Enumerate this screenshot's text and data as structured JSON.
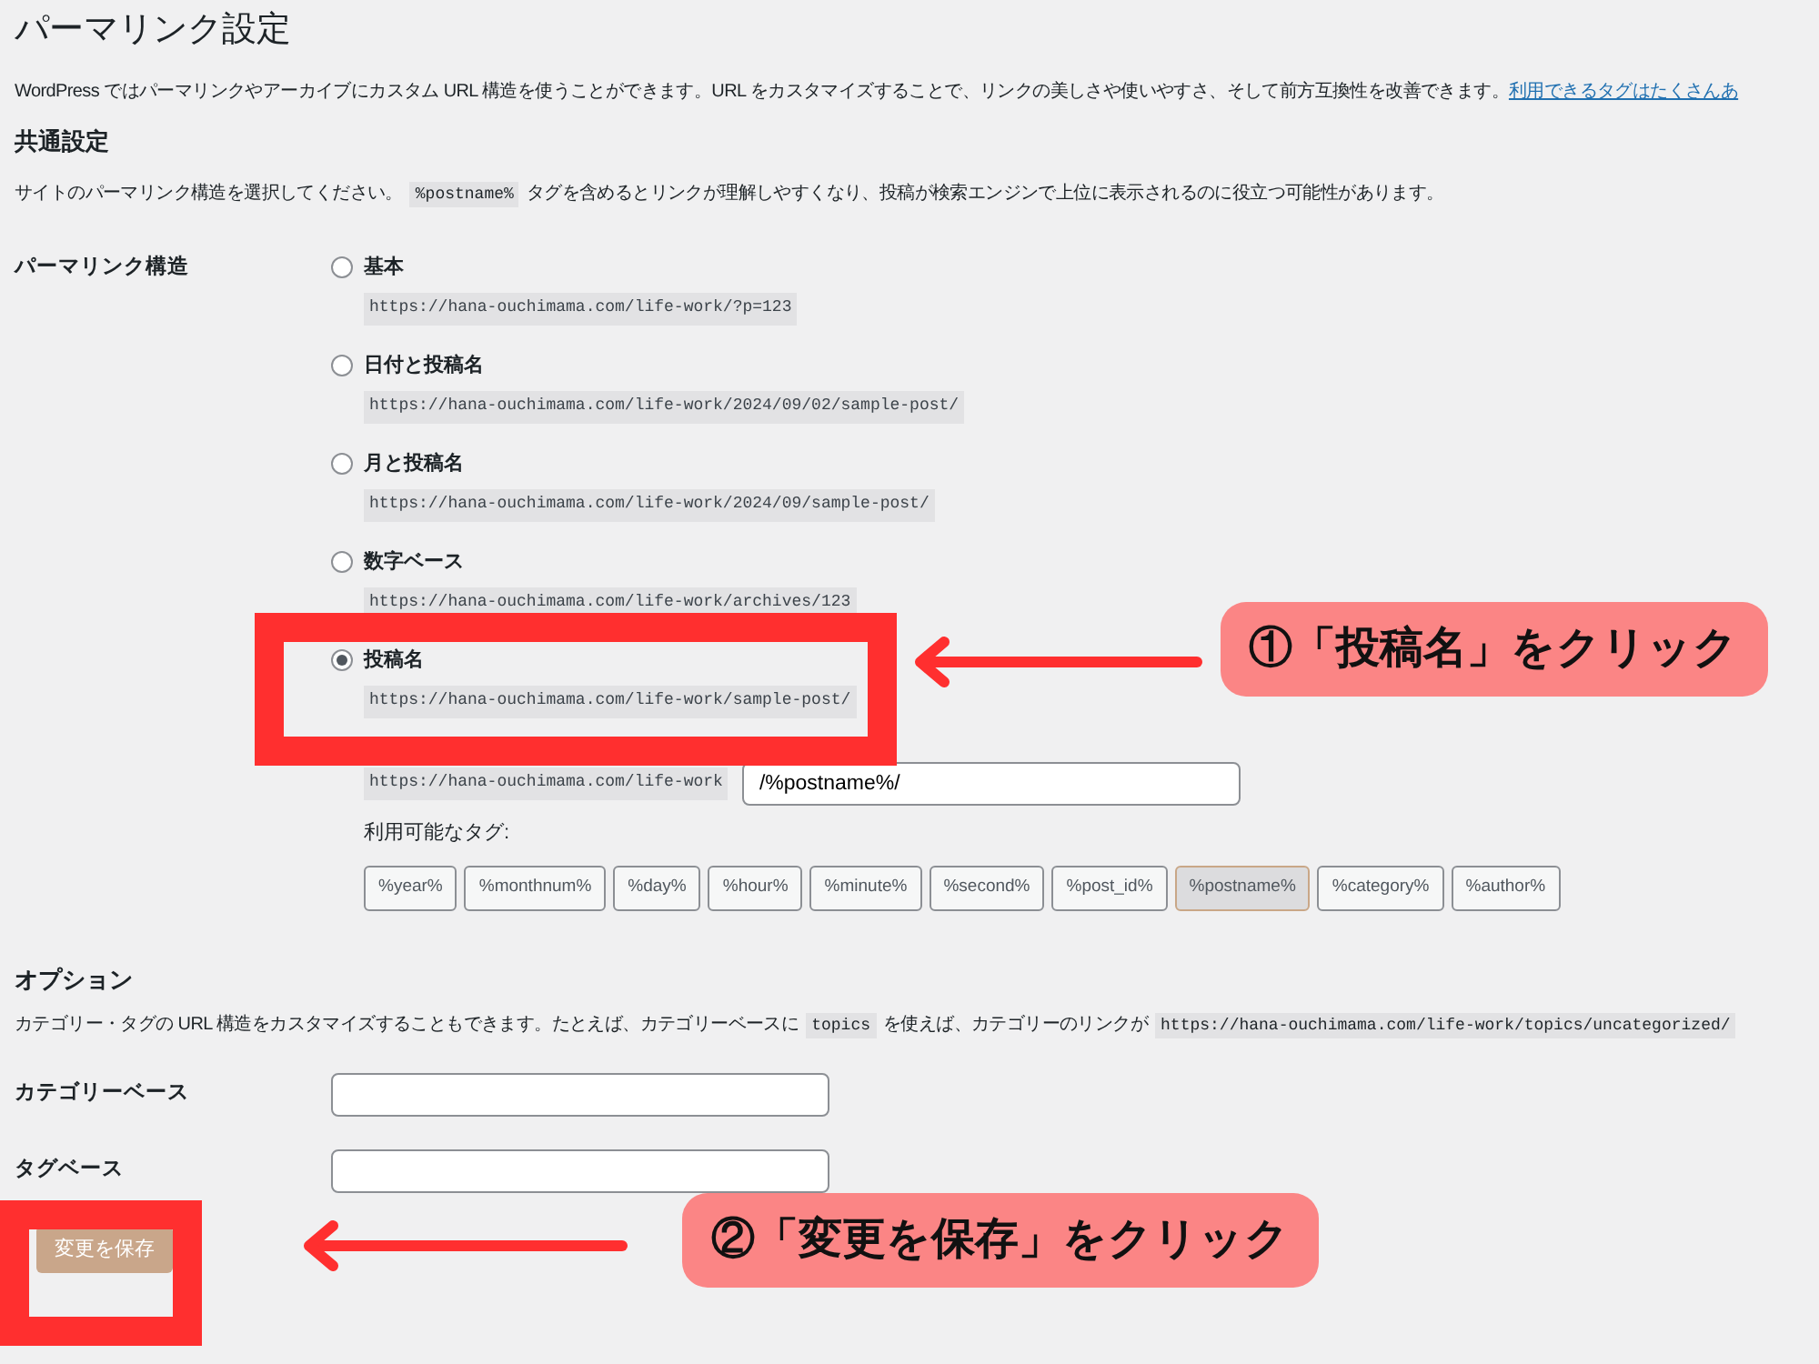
{
  "title": "パーマリンク設定",
  "intro": {
    "text": "WordPress ではパーマリンクやアーカイブにカスタム URL 構造を使うことができます。URL をカスタマイズすることで、リンクの美しさや使いやすさ、そして前方互換性を改善できます。",
    "link": "利用できるタグはたくさんあ"
  },
  "common": {
    "heading": "共通設定",
    "description": [
      {
        "kind": "text",
        "text": "サイトのパーマリンク構造を選択してください。"
      },
      {
        "kind": "code",
        "text": "%postname%"
      },
      {
        "kind": "text",
        "text": "タグを含めるとリンクが理解しやすくなり、投稿が検索エンジンで上位に表示されるのに役立つ可能性があります。"
      }
    ]
  },
  "structure": {
    "label": "パーマリンク構造",
    "options": [
      {
        "label": "基本",
        "example": "https://hana-ouchimama.com/life-work/?p=123",
        "selected": false
      },
      {
        "label": "日付と投稿名",
        "example": "https://hana-ouchimama.com/life-work/2024/09/02/sample-post/",
        "selected": false
      },
      {
        "label": "月と投稿名",
        "example": "https://hana-ouchimama.com/life-work/2024/09/sample-post/",
        "selected": false
      },
      {
        "label": "数字ベース",
        "example": "https://hana-ouchimama.com/life-work/archives/123",
        "selected": false
      },
      {
        "label": "投稿名",
        "example": "https://hana-ouchimama.com/life-work/sample-post/",
        "selected": true
      }
    ],
    "custom": {
      "prefix": "https://hana-ouchimama.com/life-work",
      "value": "/%postname%/",
      "tags_label": "利用可能なタグ:",
      "tags": [
        {
          "label": "%year%",
          "selected": false
        },
        {
          "label": "%monthnum%",
          "selected": false
        },
        {
          "label": "%day%",
          "selected": false
        },
        {
          "label": "%hour%",
          "selected": false
        },
        {
          "label": "%minute%",
          "selected": false
        },
        {
          "label": "%second%",
          "selected": false
        },
        {
          "label": "%post_id%",
          "selected": false
        },
        {
          "label": "%postname%",
          "selected": true
        },
        {
          "label": "%category%",
          "selected": false
        },
        {
          "label": "%author%",
          "selected": false
        }
      ]
    }
  },
  "options": {
    "heading": "オプション",
    "description": [
      {
        "kind": "text",
        "text": "カテゴリー・タグの URL 構造をカスタマイズすることもできます。たとえば、カテゴリーベースに"
      },
      {
        "kind": "code",
        "text": "topics"
      },
      {
        "kind": "text",
        "text": "を使えば、カテゴリーのリンクが"
      },
      {
        "kind": "code",
        "text": "https://hana-ouchimama.com/life-work/topics/uncategorized/"
      }
    ],
    "fields": [
      {
        "label": "カテゴリーベース"
      },
      {
        "label": "タグベース"
      }
    ]
  },
  "save_button": "変更を保存",
  "annotations": [
    {
      "kind": "option",
      "text": "①「投稿名」をクリック"
    },
    {
      "kind": "save",
      "text": "②「変更を保存」をクリック"
    }
  ]
}
